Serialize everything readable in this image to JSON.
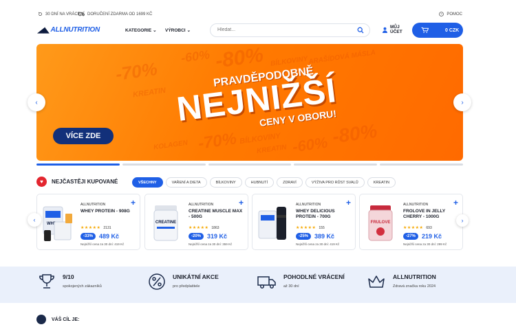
{
  "topbar": {
    "returns": "30 dní na vrácení",
    "shipping": "Doručení zdarma od 1699 Kč",
    "help": "Pomoc"
  },
  "header": {
    "logo": "ALLNUTRITION",
    "nav": [
      "KATEGORIE",
      "VÝROBCI"
    ],
    "search_placeholder": "Hledat...",
    "account_line1": "MŮJ",
    "account_line2": "ÚČET",
    "cart_value": "0 CZK"
  },
  "banner": {
    "line1": "PRAVDĚPODOBNĚ",
    "line2": "NEJNIŽŠÍ",
    "line3": "CENY V OBORU!",
    "cta": "VÍCE ZDE",
    "bg_words": [
      "-60%",
      "-70%",
      "-80%",
      "BÍLKOVINY",
      "ARAŠÍDOVÁ MÁSLA",
      "KREATIN",
      "KOLAGEN",
      "-70%",
      "BÍLKOVINY",
      "KREATIN",
      "-60%",
      "-80%"
    ],
    "slides": 5,
    "active_slide": 0
  },
  "bestsellers": {
    "title": "NEJČASTĚJI KUPOVANÉ",
    "chips": [
      "VŠECHNY",
      "VAŘENÍ A DIETA",
      "BÍLKOVINY",
      "HUBNUTÍ",
      "ZDRAVÍ",
      "VÝŽIVA PRO RŮST SVALŮ",
      "KREATIN"
    ],
    "active_chip": 0,
    "products": [
      {
        "brand": "ALLNUTRITION",
        "name": "WHEY PROTEIN - 908G",
        "stars": "★★★★★",
        "reviews": "2131",
        "discount": "-33%",
        "price": "489 Kč",
        "lowest": "Nejnižší cena za 30 dní: 419 Kč"
      },
      {
        "brand": "ALLNUTRITION",
        "name": "CREATINE MUSCLE MAX - 500G",
        "stars": "★★★★★",
        "reviews": "1863",
        "discount": "-20%",
        "price": "319 Kč",
        "lowest": "Nejnižší cena za 30 dní: 359 Kč"
      },
      {
        "brand": "ALLNUTRITION",
        "name": "WHEY DELICIOUS PROTEIN - 700G",
        "stars": "★★★★★",
        "reviews": "155",
        "discount": "-25%",
        "price": "389 Kč",
        "lowest": "Nejnižší cena za 30 dní: 419 Kč"
      },
      {
        "brand": "ALLNUTRITION",
        "name": "FROLOVE IN JELLY CHERRY - 1000G",
        "stars": "★★★★★",
        "reviews": "693",
        "discount": "-27%",
        "price": "219 Kč",
        "lowest": "Nejnižší cena za 30 dní: 299 Kč"
      }
    ]
  },
  "usp": [
    {
      "title": "9/10",
      "sub": "spokojených zákazníků",
      "icon": "trophy-icon"
    },
    {
      "title": "UNIKÁTNÍ AKCE",
      "sub": "pro předplatitele",
      "icon": "percent-icon"
    },
    {
      "title": "POHODLNÉ VRÁCENÍ",
      "sub": "až 30 dní",
      "icon": "truck-icon"
    },
    {
      "title": "ALLNUTRITION",
      "sub": "Zdravá značka roku 2024",
      "icon": "crown-icon"
    }
  ],
  "goal": {
    "title": "VÁŠ CÍL JE:"
  },
  "colors": {
    "accent": "#1f5fe6",
    "banner": "#ff7a00",
    "heart": "#e3262f",
    "usp_bg": "#eaf0fb"
  }
}
